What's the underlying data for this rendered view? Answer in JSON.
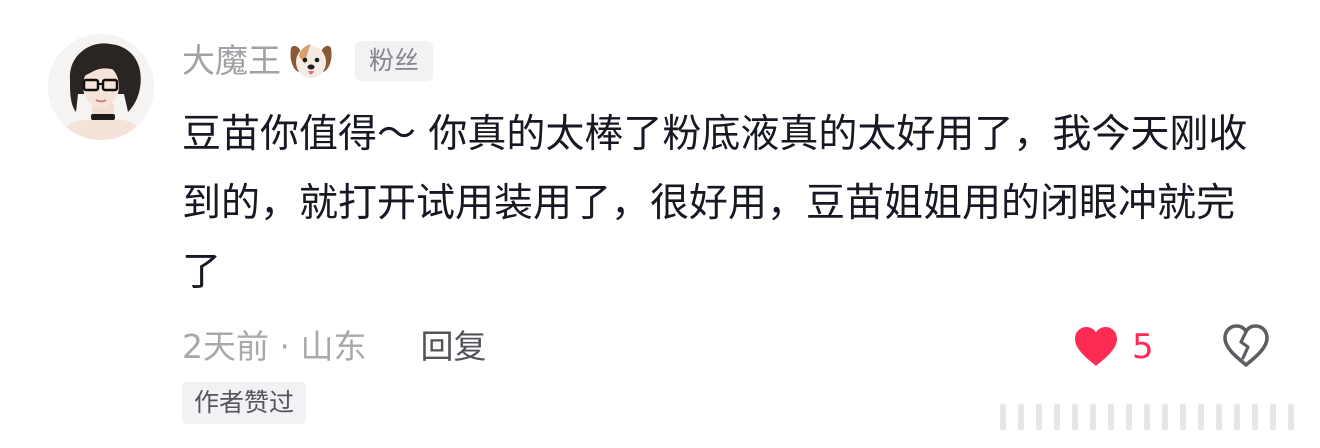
{
  "comment": {
    "username": "大魔王",
    "username_emoji": "dog-face-icon",
    "fan_badge": "粉丝",
    "content": "豆苗你值得～ 你真的太棒了粉底液真的太好用了，我今天刚收到的，就打开试用装用了，很好用，豆苗姐姐用的闭眼冲就完了",
    "meta": "2天前 · 山东",
    "reply_label": "回复",
    "like_count": "5",
    "liked": true,
    "author_liked_badge": "作者赞过"
  },
  "colors": {
    "username": "#a1a1a6",
    "content": "#161823",
    "meta": "#a8a8ad",
    "reply": "#535359",
    "like_accent": "#fe2c55",
    "badge_bg": "#f2f2f4"
  },
  "icons": {
    "avatar": "avatar-girl-glasses",
    "like": "heart-filled-icon",
    "dislike": "broken-heart-icon"
  }
}
